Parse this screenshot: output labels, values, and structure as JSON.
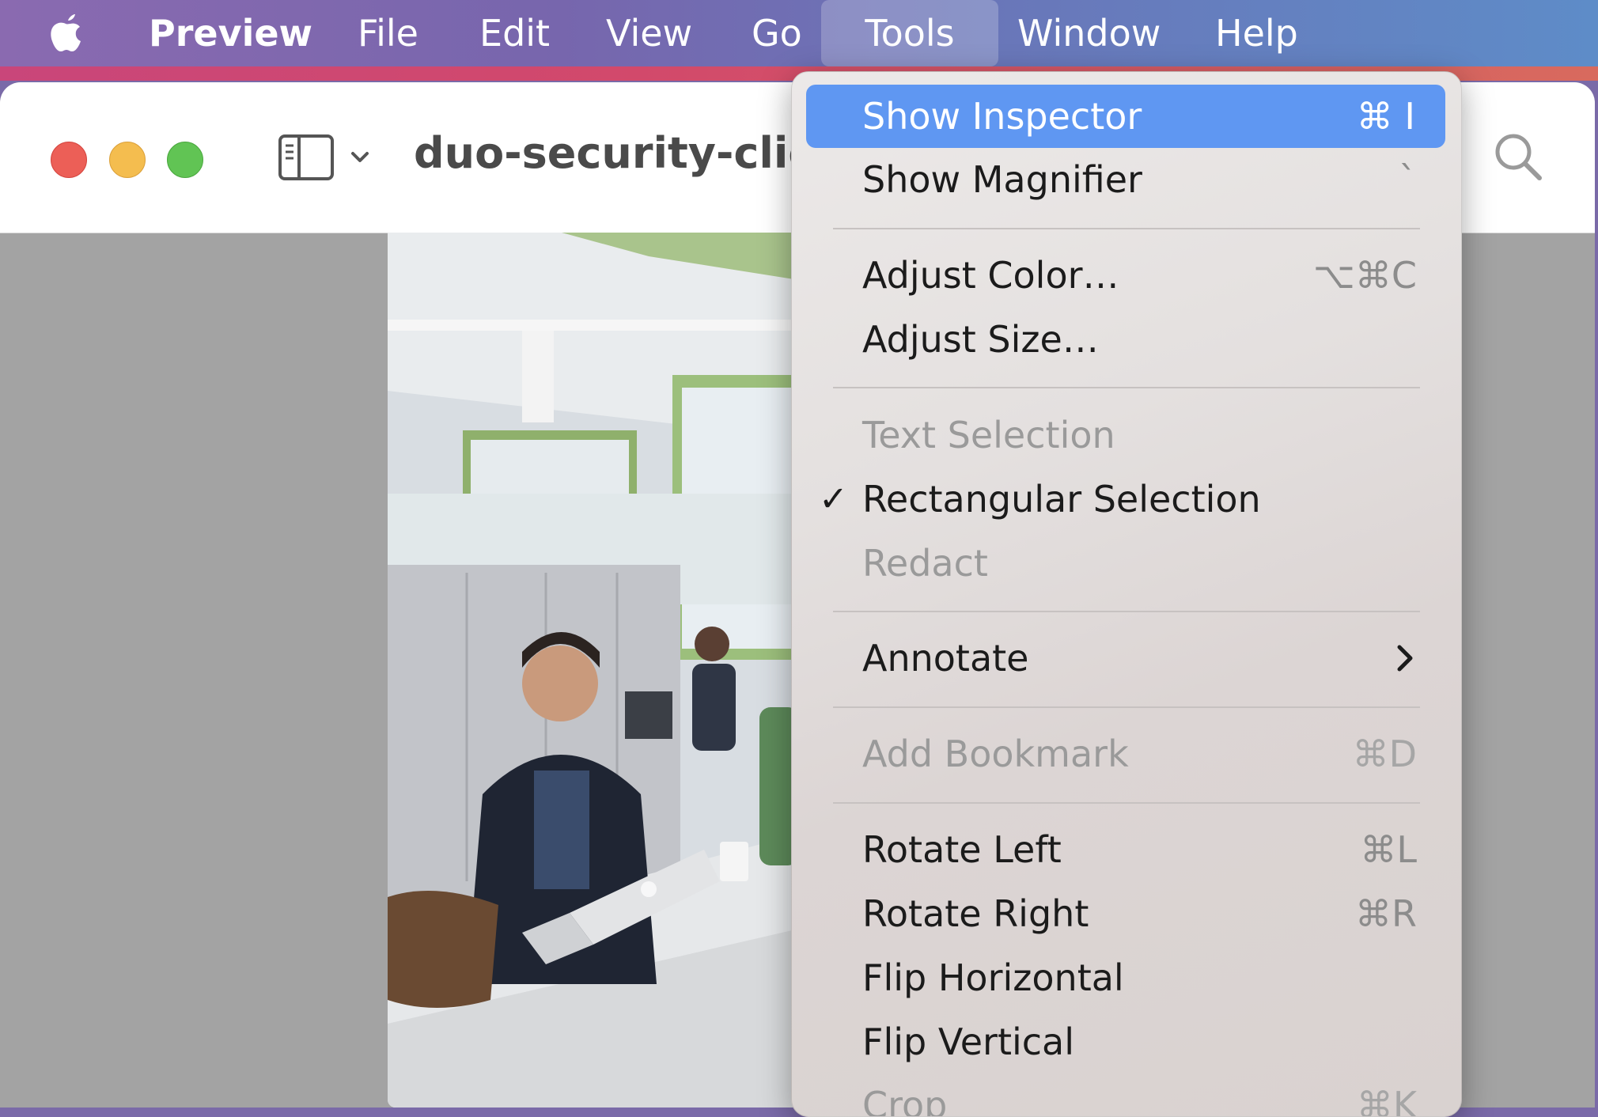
{
  "menubar": {
    "app_name": "Preview",
    "items": [
      "File",
      "Edit",
      "View",
      "Go",
      "Tools",
      "Window",
      "Help"
    ]
  },
  "window": {
    "title": "duo-security-clien"
  },
  "tools_menu": {
    "show_inspector": {
      "label": "Show Inspector",
      "shortcut": "⌘ I"
    },
    "show_magnifier": {
      "label": "Show Magnifier",
      "shortcut": "`"
    },
    "adjust_color": {
      "label": "Adjust Color…",
      "shortcut": "⌥⌘C"
    },
    "adjust_size": {
      "label": "Adjust Size…"
    },
    "text_selection": {
      "label": "Text Selection"
    },
    "rectangular_selection": {
      "label": "Rectangular Selection",
      "check": "✓"
    },
    "redact": {
      "label": "Redact"
    },
    "annotate": {
      "label": "Annotate"
    },
    "add_bookmark": {
      "label": "Add Bookmark",
      "shortcut": "⌘D"
    },
    "rotate_left": {
      "label": "Rotate Left",
      "shortcut": "⌘L"
    },
    "rotate_right": {
      "label": "Rotate Right",
      "shortcut": "⌘R"
    },
    "flip_horizontal": {
      "label": "Flip Horizontal"
    },
    "flip_vertical": {
      "label": "Flip Vertical"
    },
    "crop": {
      "label": "Crop",
      "shortcut": "⌘K"
    }
  },
  "colors": {
    "highlight": "#5f97f2",
    "close": "#ec5f57",
    "minimize": "#f4bd4f",
    "maximize": "#61c454"
  },
  "icons": [
    "apple-logo-icon",
    "sidebar-icon",
    "chevron-down-icon",
    "search-icon",
    "chevron-right-icon",
    "checkmark-icon"
  ]
}
